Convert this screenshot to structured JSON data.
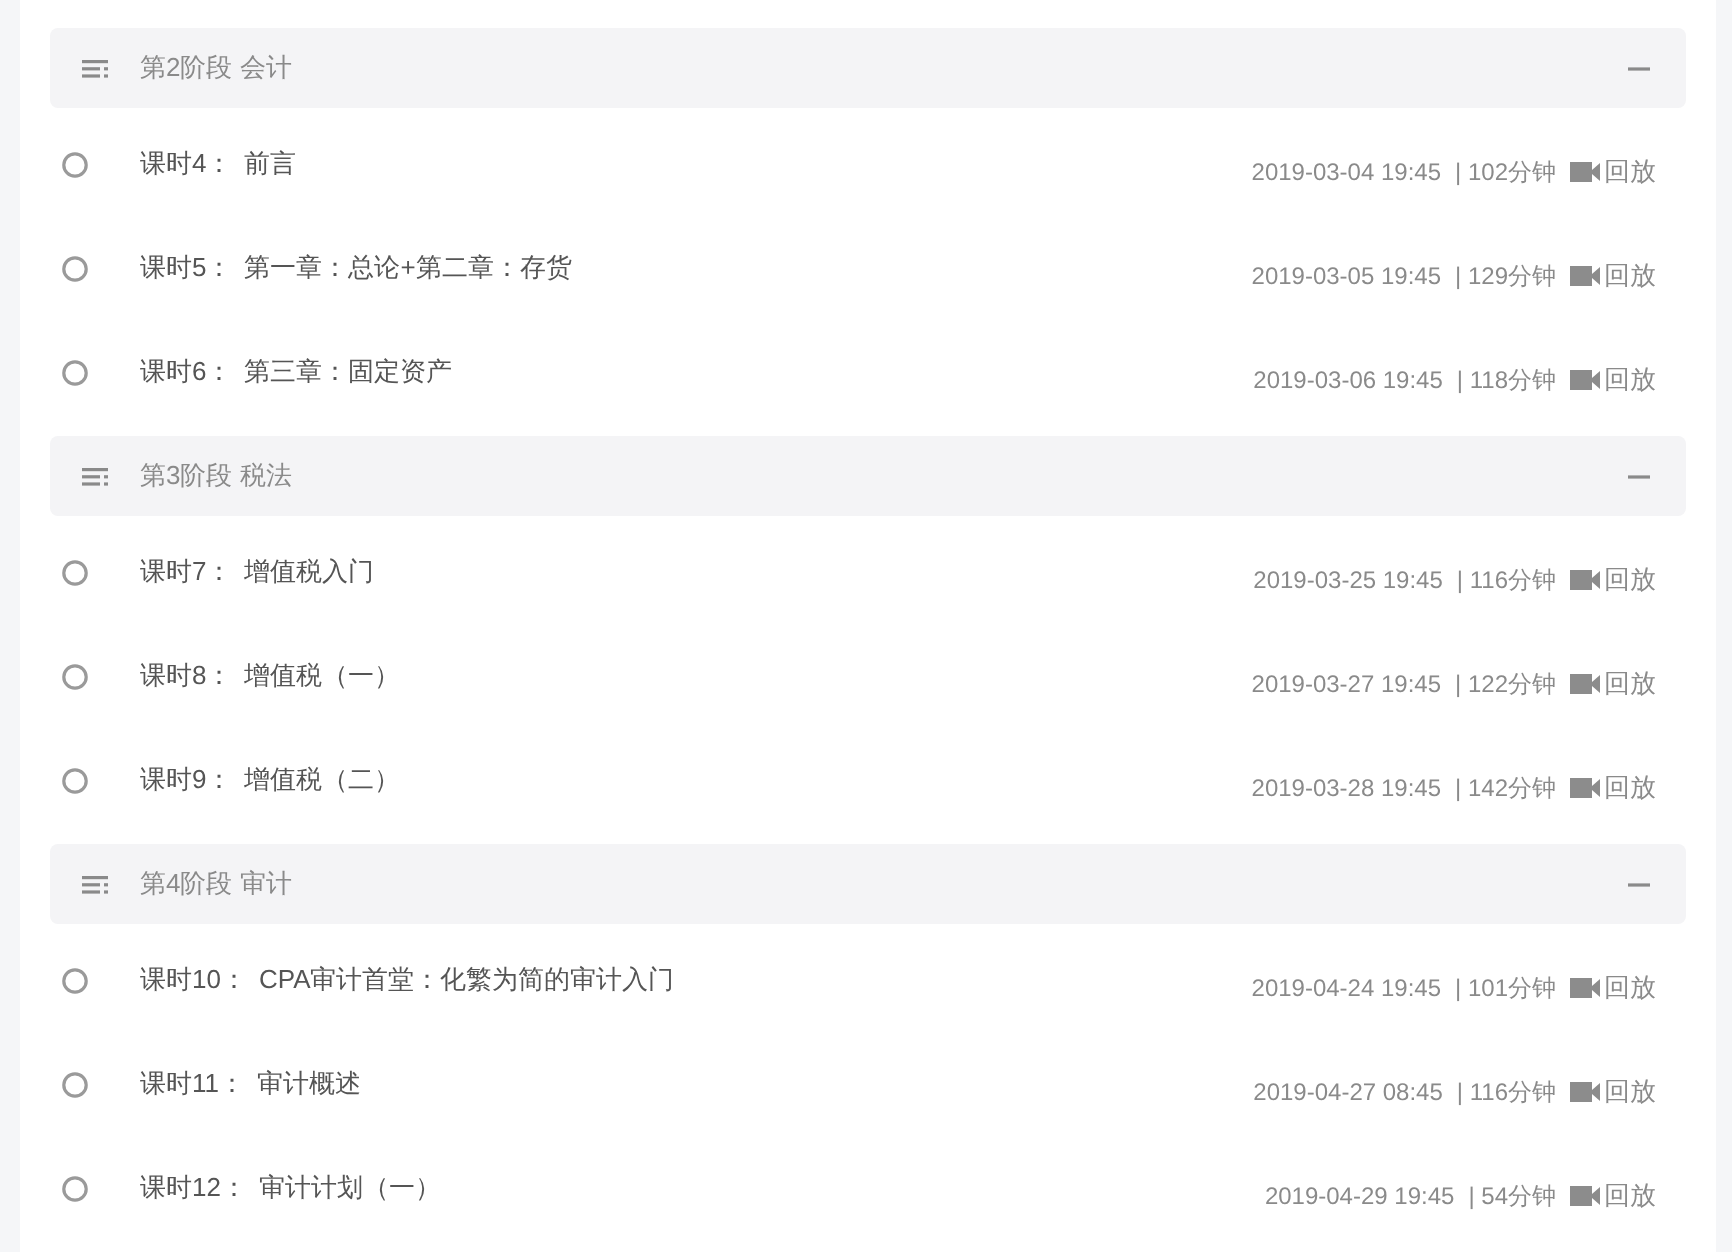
{
  "sections": [
    {
      "title": "第2阶段 会计",
      "expanded": true,
      "lessons": [
        {
          "number": "课时4：",
          "title": "前言",
          "time": "2019-03-04 19:45",
          "duration": "| 102分钟",
          "action": "回放",
          "done": false
        },
        {
          "number": "课时5：",
          "title": "第一章：总论+第二章：存货",
          "time": "2019-03-05 19:45",
          "duration": "| 129分钟",
          "action": "回放",
          "done": false
        },
        {
          "number": "课时6：",
          "title": "第三章：固定资产",
          "time": "2019-03-06 19:45",
          "duration": "| 118分钟",
          "action": "回放",
          "done": false
        }
      ]
    },
    {
      "title": "第3阶段 税法",
      "expanded": true,
      "lessons": [
        {
          "number": "课时7：",
          "title": "增值税入门",
          "time": "2019-03-25 19:45",
          "duration": "| 116分钟",
          "action": "回放",
          "done": false
        },
        {
          "number": "课时8：",
          "title": "增值税（一）",
          "time": "2019-03-27 19:45",
          "duration": "| 122分钟",
          "action": "回放",
          "done": false
        },
        {
          "number": "课时9：",
          "title": "增值税（二）",
          "time": "2019-03-28 19:45",
          "duration": "| 142分钟",
          "action": "回放",
          "done": false
        }
      ]
    },
    {
      "title": "第4阶段 审计",
      "expanded": true,
      "lessons": [
        {
          "number": "课时10：",
          "title": "CPA审计首堂：化繁为简的审计入门",
          "time": "2019-04-24 19:45",
          "duration": "| 101分钟",
          "action": "回放",
          "done": false
        },
        {
          "number": "课时11：",
          "title": "审计概述",
          "time": "2019-04-27 08:45",
          "duration": "| 116分钟",
          "action": "回放",
          "done": false
        },
        {
          "number": "课时12：",
          "title": "审计计划（一）",
          "time": "2019-04-29 19:45",
          "duration": "| 54分钟",
          "action": "回放",
          "done": false
        }
      ]
    }
  ]
}
